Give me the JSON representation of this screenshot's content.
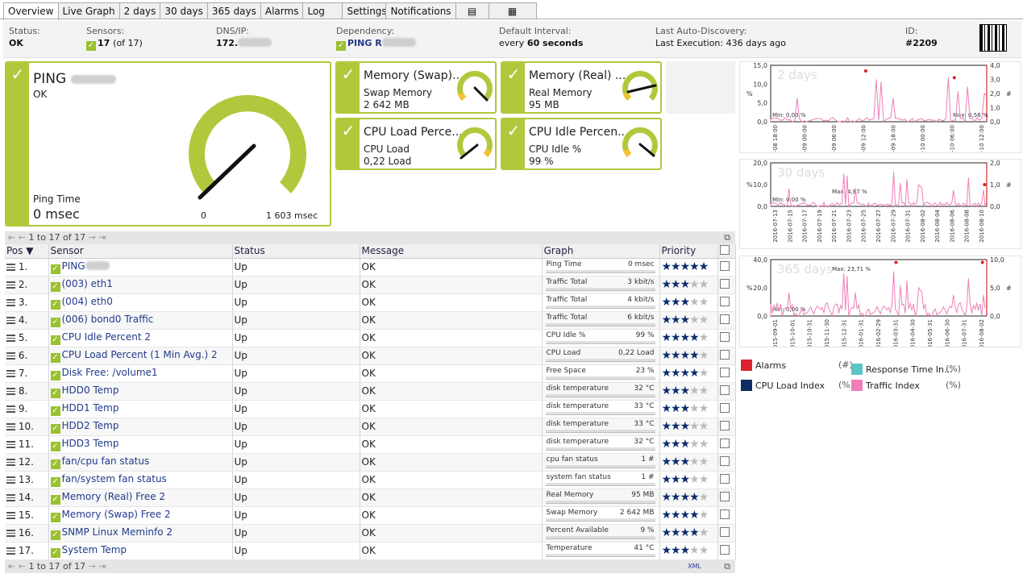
{
  "tabs": [
    "Overview",
    "Live Graph",
    "2 days",
    "30 days",
    "365 days",
    "Alarms",
    "Log",
    "Settings",
    "Notifications"
  ],
  "info": {
    "status": {
      "label": "Status:",
      "value": "OK"
    },
    "sensors": {
      "label": "Sensors:",
      "value": "17",
      "total": "(of 17)"
    },
    "dns": {
      "label": "DNS/IP:",
      "value": "172."
    },
    "dependency": {
      "label": "Dependency:",
      "value": "PING R"
    },
    "interval": {
      "label": "Default Interval:",
      "prefix": "every",
      "value": "60 seconds"
    },
    "discovery": {
      "label": "Last Auto-Discovery:",
      "value": "Last Execution: 436 days ago"
    },
    "id": {
      "label": "ID:",
      "value": "#2209"
    }
  },
  "gauges": {
    "ping": {
      "title": "PING",
      "status": "OK",
      "channel": "Ping Time",
      "value": "0 msec",
      "min": "0",
      "max": "1 603 msec"
    },
    "swap": {
      "title": "Memory (Swap)...",
      "channel": "Swap Memory",
      "value": "2 642 MB"
    },
    "real": {
      "title": "Memory (Real) ...",
      "channel": "Real Memory",
      "value": "95 MB"
    },
    "cpuload": {
      "title": "CPU Load Perce...",
      "channel": "CPU Load",
      "value": "0,22 Load"
    },
    "cpuidle": {
      "title": "CPU Idle Percen...",
      "channel": "CPU Idle %",
      "value": "99 %"
    }
  },
  "pager": {
    "text": "1 to 17 of 17",
    "xml": "XML"
  },
  "table": {
    "headers": {
      "pos": "Pos",
      "sensor": "Sensor",
      "status": "Status",
      "message": "Message",
      "graph": "Graph",
      "priority": "Priority"
    },
    "rows": [
      {
        "pos": "1.",
        "sensor": "PING",
        "status": "Up",
        "message": "OK",
        "glabel": "Ping Time",
        "gvalue": "0 msec",
        "stars": 5
      },
      {
        "pos": "2.",
        "sensor": "(003) eth1",
        "status": "Up",
        "message": "OK",
        "glabel": "Traffic Total",
        "gvalue": "3 kbit/s",
        "stars": 3
      },
      {
        "pos": "3.",
        "sensor": "(004) eth0",
        "status": "Up",
        "message": "OK",
        "glabel": "Traffic Total",
        "gvalue": "4 kbit/s",
        "stars": 3
      },
      {
        "pos": "4.",
        "sensor": "(006) bond0 Traffic",
        "status": "Up",
        "message": "OK",
        "glabel": "Traffic Total",
        "gvalue": "6 kbit/s",
        "stars": 3
      },
      {
        "pos": "5.",
        "sensor": "CPU Idle Percent 2",
        "status": "Up",
        "message": "OK",
        "glabel": "CPU Idle %",
        "gvalue": "99 %",
        "stars": 4
      },
      {
        "pos": "6.",
        "sensor": "CPU Load Percent (1 Min Avg.) 2",
        "status": "Up",
        "message": "OK",
        "glabel": "CPU Load",
        "gvalue": "0,22 Load",
        "stars": 4
      },
      {
        "pos": "7.",
        "sensor": "Disk Free: /volume1",
        "status": "Up",
        "message": "OK",
        "glabel": "Free Space",
        "gvalue": "23 %",
        "stars": 4
      },
      {
        "pos": "8.",
        "sensor": "HDD0 Temp",
        "status": "Up",
        "message": "OK",
        "glabel": "disk temperature",
        "gvalue": "32 °C",
        "stars": 3
      },
      {
        "pos": "9.",
        "sensor": "HDD1 Temp",
        "status": "Up",
        "message": "OK",
        "glabel": "disk temperature",
        "gvalue": "33 °C",
        "stars": 3
      },
      {
        "pos": "10.",
        "sensor": "HDD2 Temp",
        "status": "Up",
        "message": "OK",
        "glabel": "disk temperature",
        "gvalue": "33 °C",
        "stars": 3
      },
      {
        "pos": "11.",
        "sensor": "HDD3 Temp",
        "status": "Up",
        "message": "OK",
        "glabel": "disk temperature",
        "gvalue": "32 °C",
        "stars": 3
      },
      {
        "pos": "12.",
        "sensor": "fan/cpu fan status",
        "status": "Up",
        "message": "OK",
        "glabel": "cpu fan status",
        "gvalue": "1 #",
        "stars": 3
      },
      {
        "pos": "13.",
        "sensor": "fan/system fan status",
        "status": "Up",
        "message": "OK",
        "glabel": "system fan status",
        "gvalue": "1 #",
        "stars": 3
      },
      {
        "pos": "14.",
        "sensor": "Memory (Real) Free 2",
        "status": "Up",
        "message": "OK",
        "glabel": "Real Memory",
        "gvalue": "95 MB",
        "stars": 4
      },
      {
        "pos": "15.",
        "sensor": "Memory (Swap) Free 2",
        "status": "Up",
        "message": "OK",
        "glabel": "Swap Memory",
        "gvalue": "2 642 MB",
        "stars": 4
      },
      {
        "pos": "16.",
        "sensor": "SNMP Linux Meminfo 2",
        "status": "Up",
        "message": "OK",
        "glabel": "Percent Available",
        "gvalue": "9 %",
        "stars": 4
      },
      {
        "pos": "17.",
        "sensor": "System Temp",
        "status": "Up",
        "message": "OK",
        "glabel": "Temperature",
        "gvalue": "41 °C",
        "stars": 3
      }
    ]
  },
  "chart_data": [
    {
      "type": "line",
      "title": "2 days",
      "yleft": {
        "unit": "%",
        "ticks": [
          "15,0",
          "10,0",
          "5,0",
          "0,0"
        ]
      },
      "yright": {
        "unit": "#",
        "ticks": [
          "4,0",
          "3,0",
          "2,0",
          "1,0",
          "0,0"
        ]
      },
      "xticks": [
        "08-08 18:00",
        "08-09 00:00",
        "08-09 06:00",
        "08-09 12:00",
        "08-09 18:00",
        "08-10 00:00",
        "08-10 06:00",
        "08-10 12:00"
      ],
      "min_label": "Min: 0,00 %",
      "max_label": "Max: 0,56 %"
    },
    {
      "type": "line",
      "title": "30 days",
      "yleft": {
        "unit": "%",
        "ticks": [
          "20,0",
          "10,0",
          "0,0"
        ]
      },
      "yright": {
        "unit": "#",
        "ticks": [
          "2,0",
          "1,0",
          "0,0"
        ]
      },
      "xticks": [
        "2016-07-13",
        "2016-07-15",
        "2016-07-17",
        "2016-07-19",
        "2016-07-21",
        "2016-07-23",
        "2016-07-25",
        "2016-07-27",
        "2016-07-29",
        "2016-07-31",
        "2016-08-02",
        "2016-08-04",
        "2016-08-06",
        "2016-08-08",
        "2016-08-10"
      ],
      "min_label": "Min: 0,00 %",
      "max_label": "Max: 4,87 %"
    },
    {
      "type": "line",
      "title": "365 days",
      "yleft": {
        "unit": "%",
        "ticks": [
          "40,0",
          "20,0",
          "0,0"
        ]
      },
      "yright": {
        "unit": "#",
        "ticks": [
          "10,0",
          "5,0",
          "0,0"
        ]
      },
      "xticks": [
        "2015-09-01",
        "2015-10-01",
        "2015-10-31",
        "2015-11-30",
        "2015-12-31",
        "2016-01-31",
        "2016-02-29",
        "2016-03-31",
        "2016-04-30",
        "2016-05-31",
        "2016-06-30",
        "2016-07-31",
        "2016-08-02"
      ],
      "min_label": "Min: 0,00 %",
      "max_label": "Max: 23,71 %"
    }
  ],
  "legend": [
    {
      "name": "Alarms",
      "unit": "(#)",
      "color": "#d9232e"
    },
    {
      "name": "Response Time In...",
      "unit": "(%)",
      "color": "#5ec4c4"
    },
    {
      "name": "CPU Load Index",
      "unit": "(%)",
      "color": "#0f2d62"
    },
    {
      "name": "Traffic Index",
      "unit": "(%)",
      "color": "#ee7fb7"
    }
  ],
  "colors": {
    "accent": "#b0c93c",
    "status_ok": "#9bc130",
    "star": "#0b2d6e"
  }
}
